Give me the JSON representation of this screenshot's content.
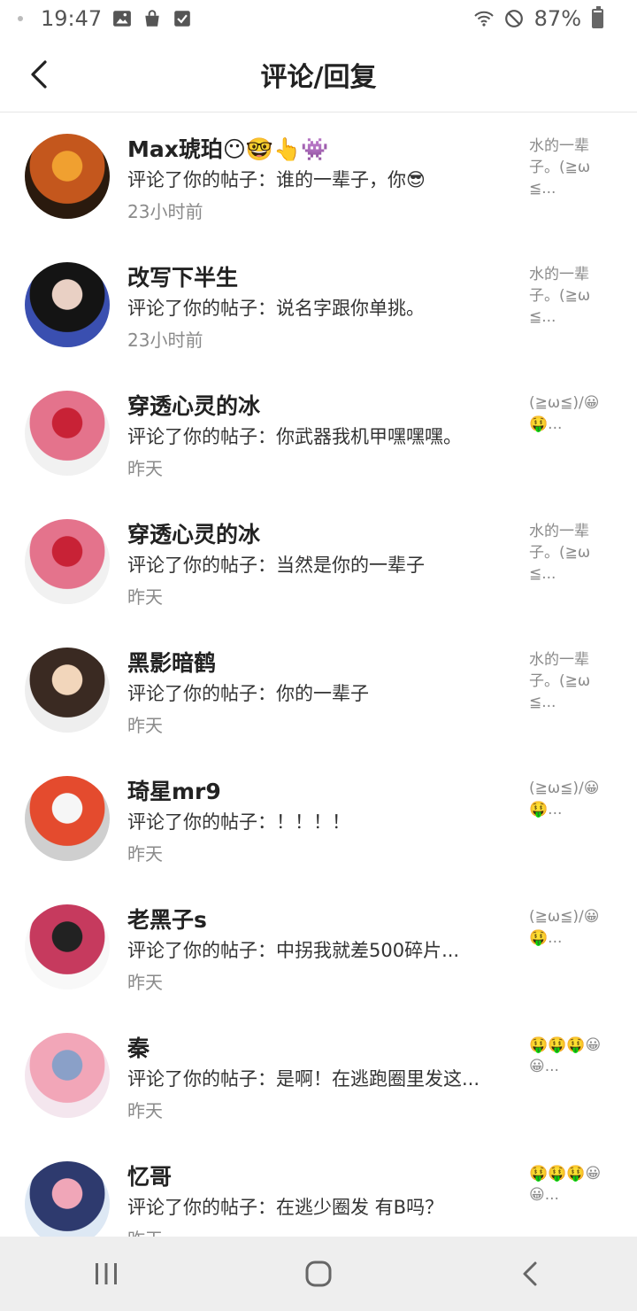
{
  "status": {
    "time": "19:47",
    "battery": "87%",
    "battery_level": 0.87
  },
  "header": {
    "title": "评论/回复",
    "back_icon": "chevron-left-icon"
  },
  "items": [
    {
      "name": "Max琥珀😶🤓👆👾",
      "comment": "评论了你的帖子：谁的一辈子，你😎",
      "time": "23小时前",
      "preview": "水的一辈子。(≧ω≦...",
      "avatar_colors": [
        "#2a1a0e",
        "#c4571d",
        "#f0a030"
      ]
    },
    {
      "name": "改写下半生",
      "comment": "评论了你的帖子：说名字跟你单挑。",
      "time": "23小时前",
      "preview": "水的一辈子。(≧ω≦...",
      "avatar_colors": [
        "#3a4fb0",
        "#141414",
        "#e9d0c4"
      ]
    },
    {
      "name": "穿透心灵的冰",
      "comment": "评论了你的帖子：你武器我机甲嘿嘿嘿。",
      "time": "昨天",
      "preview": "(≧ω≦)/😀🤑...",
      "avatar_colors": [
        "#f1f1f1",
        "#e4738c",
        "#c82236"
      ]
    },
    {
      "name": "穿透心灵的冰",
      "comment": "评论了你的帖子：当然是你的一辈子",
      "time": "昨天",
      "preview": "水的一辈子。(≧ω≦...",
      "avatar_colors": [
        "#f1f1f1",
        "#e4738c",
        "#c82236"
      ]
    },
    {
      "name": "黑影暗鹤",
      "comment": "评论了你的帖子：你的一辈子",
      "time": "昨天",
      "preview": "水的一辈子。(≧ω≦...",
      "avatar_colors": [
        "#eeeeee",
        "#3a2a22",
        "#f2d6bb"
      ]
    },
    {
      "name": "琦星mr9",
      "comment": "评论了你的帖子：！！！！",
      "time": "昨天",
      "preview": "(≧ω≦)/😀🤑...",
      "avatar_colors": [
        "#cfcfcf",
        "#e44b2e",
        "#f6f6f6"
      ]
    },
    {
      "name": "老黑子s",
      "comment": "评论了你的帖子：中拐我就差500碎片...",
      "time": "昨天",
      "preview": "(≧ω≦)/😀🤑...",
      "avatar_colors": [
        "#f8f8f8",
        "#c63a5e",
        "#222222"
      ]
    },
    {
      "name": "秦",
      "comment": "评论了你的帖子：是啊！在逃跑圈里发这...",
      "time": "昨天",
      "preview": "🤑🤑🤑😀😀...",
      "avatar_colors": [
        "#f4e6ee",
        "#f2a6b8",
        "#8aa0c8"
      ]
    },
    {
      "name": "忆哥",
      "comment": "评论了你的帖子：在逃少圈发 有B吗？",
      "time": "昨天",
      "preview": "🤑🤑🤑😀😀...",
      "avatar_colors": [
        "#dde8f4",
        "#2e3a6e",
        "#f0a6b8"
      ]
    }
  ],
  "nav": {
    "recent_icon": "recent-apps-icon",
    "home_icon": "home-icon",
    "back_icon": "back-icon"
  }
}
